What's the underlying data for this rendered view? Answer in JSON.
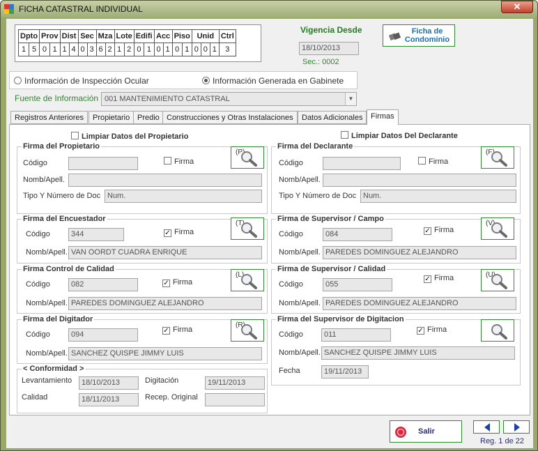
{
  "window": {
    "title": "FICHA CATASTRAL INDIVIDUAL",
    "close_label": "✕"
  },
  "codes": {
    "headers": [
      "Dpto",
      "Prov",
      "Dist",
      "Sec",
      "Mza",
      "Lote",
      "Edifi",
      "Acc",
      "Piso",
      "Unid",
      "Ctrl"
    ],
    "digits": [
      "1",
      "5",
      "0",
      "1",
      "1",
      "4",
      "0",
      "3",
      "6",
      "2",
      "1",
      "2",
      "0",
      "1",
      "0",
      "1",
      "0",
      "1",
      "0",
      "0",
      "1",
      "3"
    ]
  },
  "vigencia": {
    "label": "Vigencia Desde",
    "date": "18/10/2013",
    "sec": "Sec.: 0002"
  },
  "condominio_button": "Ficha de Condominio",
  "radio": {
    "inspeccion": "Información de Inspección Ocular",
    "gabinete": "Información Generada en Gabinete"
  },
  "fuente": {
    "label": "Fuente de Información :",
    "value": "001  MANTENIMIENTO CATASTRAL"
  },
  "tabs": [
    "Registros Anteriores",
    "Propietario",
    "Predio",
    "Construcciones y Otras Instalaciones",
    "Datos Adicionales",
    "Firmas"
  ],
  "limpiar_propietario": "Limpiar Datos del Propietario",
  "limpiar_declarante": "Limpiar Datos Del Declarante",
  "labels": {
    "codigo": "Código",
    "nombapell_prop": "Nomb/Apell.",
    "nombapell": "Nomb/Apell.",
    "tipo_doc": "Tipo Y Número de Doc",
    "firma": "Firma",
    "num_placeholder": "Num.",
    "fecha": "Fecha"
  },
  "propietario": {
    "title": "Firma del Propietario",
    "letter": "(P)",
    "codigo": "",
    "nombre": ""
  },
  "declarante": {
    "title": "Firma del Declarante",
    "letter": "(F)",
    "codigo": "",
    "nombre": ""
  },
  "encuestador": {
    "title": "Firma del Encuestador",
    "letter": "(T)",
    "codigo": "344",
    "nombre": "VAN OORDT CUADRA  ENRIQUE"
  },
  "sup_campo": {
    "title": "Firma de Supervisor / Campo",
    "letter": "(V)",
    "codigo": "084",
    "nombre": "PAREDES DOMINGUEZ  ALEJANDRO"
  },
  "control_calidad": {
    "title": "Firma Control de Calidad",
    "letter": "(L)",
    "codigo": "082",
    "nombre": "PAREDES DOMINGUEZ  ALEJANDRO"
  },
  "sup_calidad": {
    "title": "Firma de Supervisor / Calidad",
    "letter": "(U)",
    "codigo": "055",
    "nombre": "PAREDES DOMINGUEZ  ALEJANDRO"
  },
  "digitador": {
    "title": "Firma del Digitador",
    "letter": "(R)",
    "codigo": "094",
    "nombre": "SANCHEZ QUISPE  JIMMY LUIS"
  },
  "sup_digitacion": {
    "title": "Firma del Supervisor de Digitacion",
    "codigo": "011",
    "nombre": "SANCHEZ QUISPE  JIMMY LUIS",
    "fecha": "19/11/2013"
  },
  "conformidad": {
    "title": "< Conformidad >",
    "levantamiento_label": "Levantamiento",
    "levantamiento": "18/10/2013",
    "digitacion_label": "Digitación",
    "digitacion": "19/11/2013",
    "calidad_label": "Calidad",
    "calidad": "18/11/2013",
    "recep_label": "Recep. Original",
    "recep": ""
  },
  "salir": "Salir",
  "reg": "Reg. 1 de 22",
  "colors": {
    "accent_green": "#2e8b2e",
    "title_green": "#1e7d1e",
    "exit_red": "#d9283b",
    "nav_blue": "#1c3fa8"
  }
}
